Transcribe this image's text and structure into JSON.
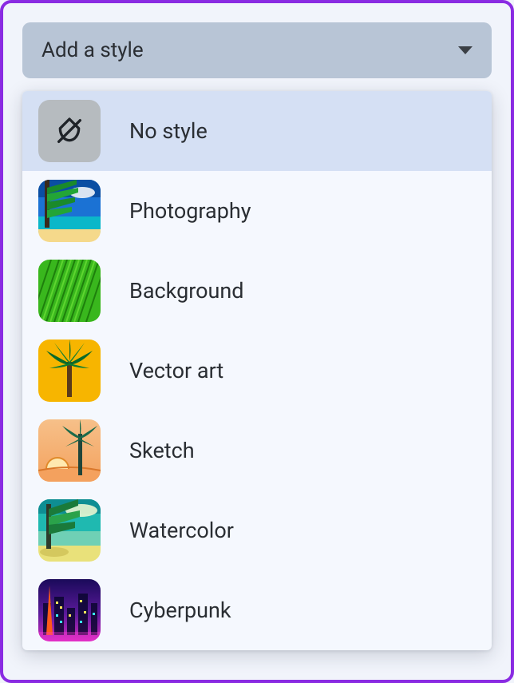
{
  "dropdown": {
    "placeholder": "Add a style",
    "options": [
      {
        "id": "no-style",
        "label": "No style",
        "selected": true
      },
      {
        "id": "photography",
        "label": "Photography",
        "selected": false
      },
      {
        "id": "background",
        "label": "Background",
        "selected": false
      },
      {
        "id": "vector-art",
        "label": "Vector art",
        "selected": false
      },
      {
        "id": "sketch",
        "label": "Sketch",
        "selected": false
      },
      {
        "id": "watercolor",
        "label": "Watercolor",
        "selected": false
      },
      {
        "id": "cyberpunk",
        "label": "Cyberpunk",
        "selected": false
      }
    ]
  }
}
